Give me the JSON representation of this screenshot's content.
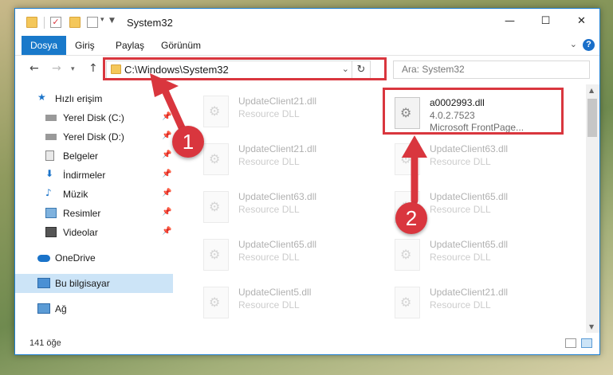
{
  "window": {
    "title": "System32",
    "controls": {
      "minimize": "—",
      "maximize": "☐",
      "close": "✕"
    }
  },
  "ribbon": {
    "tabs": [
      "Dosya",
      "Giriş",
      "Paylaş",
      "Görünüm"
    ],
    "active_tab": "Dosya",
    "help": "?"
  },
  "nav": {
    "address": "C:\\Windows\\System32",
    "search_placeholder": "Ara: System32"
  },
  "sidebar": {
    "items": [
      {
        "label": "Hızlı erişim",
        "icon": "star-icon"
      },
      {
        "label": "Yerel Disk (C:)",
        "icon": "drive-icon",
        "pinned": true
      },
      {
        "label": "Yerel Disk (D:)",
        "icon": "drive-icon",
        "pinned": true
      },
      {
        "label": "Belgeler",
        "icon": "documents-icon",
        "pinned": true
      },
      {
        "label": "İndirmeler",
        "icon": "download-icon",
        "pinned": true
      },
      {
        "label": "Müzik",
        "icon": "music-icon",
        "pinned": true
      },
      {
        "label": "Resimler",
        "icon": "pictures-icon",
        "pinned": true
      },
      {
        "label": "Videolar",
        "icon": "videos-icon",
        "pinned": true
      },
      {
        "label": "OneDrive",
        "icon": "cloud-icon"
      },
      {
        "label": "Bu bilgisayar",
        "icon": "computer-icon",
        "selected": true
      },
      {
        "label": "Ağ",
        "icon": "network-icon"
      }
    ]
  },
  "files": {
    "highlighted": {
      "name": "a0002993.dll",
      "version": "4.0.2.7523",
      "description": "Microsoft FrontPage..."
    },
    "faded": [
      {
        "name": "UpdateClient21.dll",
        "type": "Resource DLL"
      },
      {
        "name": "UpdateClient21.dll",
        "type": "Resource DLL"
      },
      {
        "name": "UpdateClient63.dll",
        "type": "Resource DLL"
      },
      {
        "name": "UpdateClient63.dll",
        "type": "Resource DLL"
      },
      {
        "name": "UpdateClient65.dll",
        "type": "Resource DLL"
      },
      {
        "name": "UpdateClient65.dll",
        "type": "Resource DLL"
      },
      {
        "name": "UpdateClient65.dll",
        "type": "Resource DLL"
      },
      {
        "name": "UpdateClient5.dll",
        "type": "Resource DLL"
      },
      {
        "name": "UpdateClient21.dll",
        "type": "Resource DLL"
      }
    ]
  },
  "status": {
    "item_count": "141 öğe"
  },
  "annotations": {
    "step1": "1",
    "step2": "2"
  },
  "colors": {
    "accent": "#1979ca",
    "highlight": "#d9363e"
  }
}
